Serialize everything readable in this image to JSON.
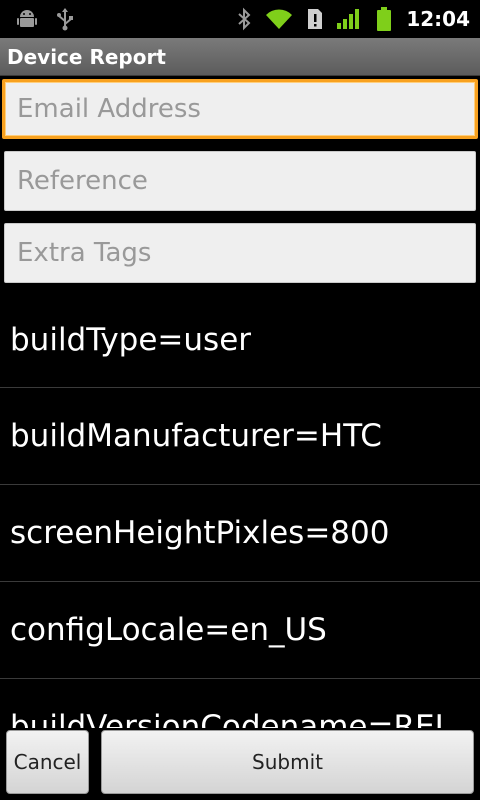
{
  "status_bar": {
    "left_icons": [
      "android-debug-icon",
      "usb-icon"
    ],
    "right_icons": [
      "bluetooth-icon",
      "wifi-icon",
      "notification-alert-icon",
      "signal-icon",
      "battery-icon"
    ],
    "time": "12:04",
    "colors": {
      "wifi": "#7fcf1a",
      "signal": "#7fcf1a",
      "battery": "#7fcf1a"
    }
  },
  "title_bar": {
    "title": "Device Report"
  },
  "form": {
    "email": {
      "placeholder": "Email Address",
      "value": ""
    },
    "reference": {
      "placeholder": "Reference",
      "value": ""
    },
    "extra_tags": {
      "placeholder": "Extra Tags",
      "value": ""
    }
  },
  "info_items": [
    "buildType=user",
    "buildManufacturer=HTC",
    "screenHeightPixles=800",
    "configLocale=en_US",
    "buildVersionCodename=REL"
  ],
  "buttons": {
    "cancel": "Cancel",
    "submit": "Submit"
  },
  "accent_color": "#f8a11f"
}
